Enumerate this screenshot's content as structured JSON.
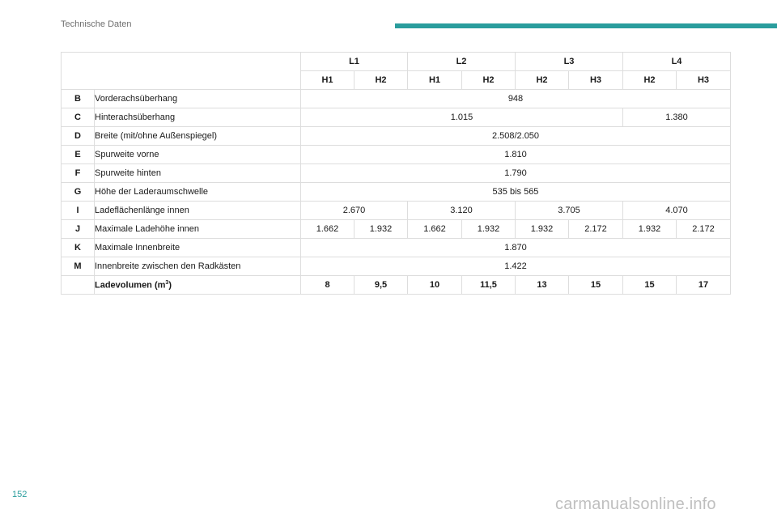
{
  "header": {
    "section_title": "Technische Daten"
  },
  "table": {
    "length_headers": [
      "L1",
      "L2",
      "L3",
      "L4"
    ],
    "height_headers": [
      "H1",
      "H2",
      "H1",
      "H2",
      "H2",
      "H3",
      "H2",
      "H3"
    ],
    "rows": [
      {
        "code": "B",
        "label": "Vorderachsüberhang",
        "values": [
          "948"
        ]
      },
      {
        "code": "C",
        "label": "Hinterachsüberhang",
        "values": [
          "1.015",
          "1.380"
        ]
      },
      {
        "code": "D",
        "label": "Breite (mit/ohne Außenspiegel)",
        "values": [
          "2.508/2.050"
        ]
      },
      {
        "code": "E",
        "label": "Spurweite vorne",
        "values": [
          "1.810"
        ]
      },
      {
        "code": "F",
        "label": "Spurweite hinten",
        "values": [
          "1.790"
        ]
      },
      {
        "code": "G",
        "label": "Höhe der Laderaumschwelle",
        "values": [
          "535 bis 565"
        ]
      },
      {
        "code": "I",
        "label": "Ladeflächenlänge innen",
        "values": [
          "2.670",
          "3.120",
          "3.705",
          "4.070"
        ]
      },
      {
        "code": "J",
        "label": "Maximale Ladehöhe innen",
        "values": [
          "1.662",
          "1.932",
          "1.662",
          "1.932",
          "1.932",
          "2.172",
          "1.932",
          "2.172"
        ]
      },
      {
        "code": "K",
        "label": "Maximale Innenbreite",
        "values": [
          "1.870"
        ]
      },
      {
        "code": "M",
        "label": "Innenbreite zwischen den Radkästen",
        "values": [
          "1.422"
        ]
      }
    ],
    "volume": {
      "label": "Ladevolumen (m",
      "unit_exp": "3",
      "label_end": ")",
      "values": [
        "8",
        "9,5",
        "10",
        "11,5",
        "13",
        "15",
        "15",
        "17"
      ]
    }
  },
  "footer": {
    "page_number": "152",
    "watermark": "carmanualsonline.info"
  }
}
